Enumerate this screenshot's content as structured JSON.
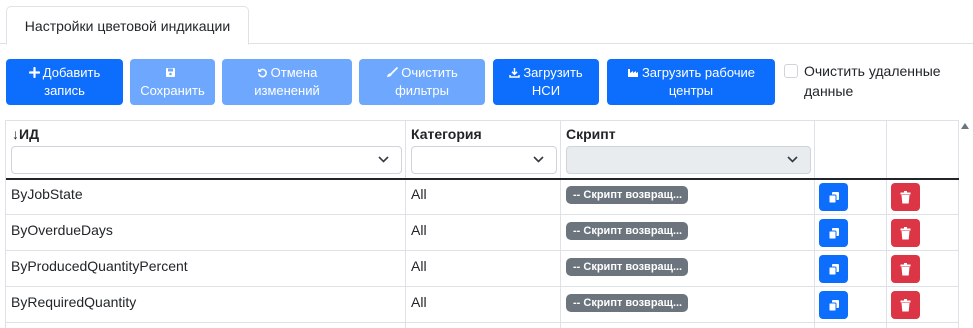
{
  "tab": {
    "label": "Настройки цветовой индикации"
  },
  "toolbar": {
    "add": {
      "line1": "Добавить",
      "line2": "запись",
      "icon": "plus-icon"
    },
    "save": {
      "line1": "Сохранить",
      "icon": "floppy-icon"
    },
    "undo": {
      "line1": "Отмена",
      "line2": "изменений",
      "icon": "undo-icon"
    },
    "clear_filters": {
      "line1": "Очистить",
      "line2": "фильтры",
      "icon": "brush-icon"
    },
    "load_nsi": {
      "line1": "Загрузить",
      "line2": "НСИ",
      "icon": "download-icon"
    },
    "load_centers": {
      "line1": "Загрузить рабочие",
      "line2": "центры",
      "icon": "factory-icon"
    },
    "clear_deleted": {
      "line1": "Очистить удаленные",
      "line2": "данные",
      "checked": false
    }
  },
  "table": {
    "columns": {
      "id": "ИД",
      "category": "Категория",
      "script": "Скрипт"
    },
    "sort_indicator": "↓",
    "rows": [
      {
        "id": "ByJobState",
        "category": "All",
        "script": "-- Скрипт возвращ..."
      },
      {
        "id": "ByOverdueDays",
        "category": "All",
        "script": "-- Скрипт возвращ..."
      },
      {
        "id": "ByProducedQuantityPercent",
        "category": "All",
        "script": "-- Скрипт возвращ..."
      },
      {
        "id": "ByRequiredQuantity",
        "category": "All",
        "script": "-- Скрипт возвращ..."
      }
    ]
  },
  "colors": {
    "primary": "#0d6efd",
    "primary_disabled": "#6ea8fe",
    "danger": "#dc3545",
    "badge": "#6c757d",
    "border": "#dee2e6"
  }
}
